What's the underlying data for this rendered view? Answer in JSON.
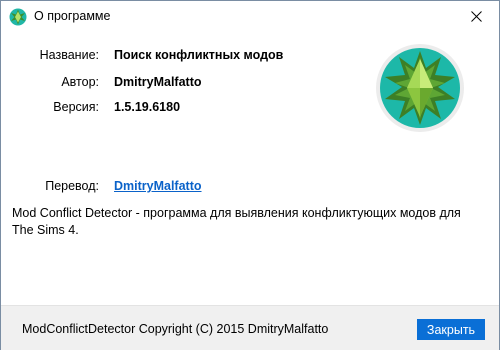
{
  "window": {
    "title": "О программе",
    "app_icon": "sims-plumbob-icon",
    "close_icon": "close-icon"
  },
  "info": {
    "name_label": "Название:",
    "name_value": "Поиск конфликтных модов",
    "author_label": "Автор:",
    "author_value": "DmitryMalfatto",
    "version_label": "Версия:",
    "version_value": "1.5.19.6180",
    "translation_label": "Перевод:",
    "translation_value": "DmitryMalfatto"
  },
  "description": "Mod Conflict Detector - программа для выявления конфликтующих модов для The Sims 4.",
  "footer": {
    "copyright": "ModConflictDetector Copyright (C) 2015 DmitryMalfatto",
    "close_label": "Закрыть"
  },
  "colors": {
    "accent": "#0a6fd6",
    "link": "#0a62c9",
    "logo_teal": "#1db8a8",
    "logo_green": "#8cc63f"
  }
}
